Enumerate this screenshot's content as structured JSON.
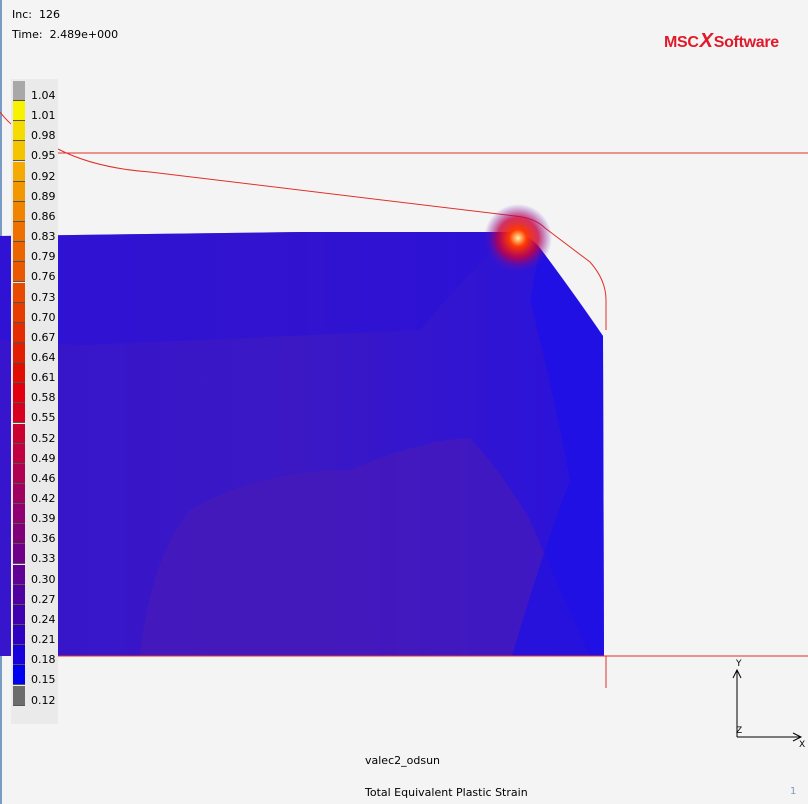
{
  "header": {
    "increment_label": "Inc:",
    "increment_value": "126",
    "time_label": "Time:",
    "time_value": "2.489e+000"
  },
  "logo": {
    "left": "MSC",
    "right": "Software",
    "mark": "X"
  },
  "legend": {
    "title": "Total Equivalent Plastic Strain",
    "labels": [
      "1.04",
      "1.01",
      "0.98",
      "0.95",
      "0.92",
      "0.89",
      "0.86",
      "0.83",
      "0.79",
      "0.76",
      "0.73",
      "0.70",
      "0.67",
      "0.64",
      "0.61",
      "0.58",
      "0.55",
      "0.52",
      "0.49",
      "0.46",
      "0.42",
      "0.39",
      "0.36",
      "0.33",
      "0.30",
      "0.27",
      "0.24",
      "0.21",
      "0.18",
      "0.15",
      "0.12"
    ],
    "colors": [
      "#a8a8a8",
      "#f7f300",
      "#f5dc00",
      "#f5c400",
      "#f4aa00",
      "#f29700",
      "#f08300",
      "#ee7000",
      "#ec6400",
      "#ea5800",
      "#e84a00",
      "#e63c00",
      "#e42c00",
      "#e21e00",
      "#e00e00",
      "#e00010",
      "#d80020",
      "#cc0030",
      "#c00040",
      "#b00050",
      "#a00060",
      "#900070",
      "#80007a",
      "#700088",
      "#600094",
      "#5000a0",
      "#4000b0",
      "#3000c0",
      "#1800dc",
      "#0000f0",
      "#6c6c6c"
    ]
  },
  "footer": {
    "job_name": "valec2_odsun",
    "plot_title": "Total Equivalent Plastic Strain",
    "page_number": "1"
  },
  "axes": {
    "y_label": "Y",
    "z_label": "Z",
    "x_label": "X"
  },
  "colors": {
    "outline": "#e0302a",
    "mesh_base": "#3a13c8",
    "background": "#f4f4f4"
  }
}
